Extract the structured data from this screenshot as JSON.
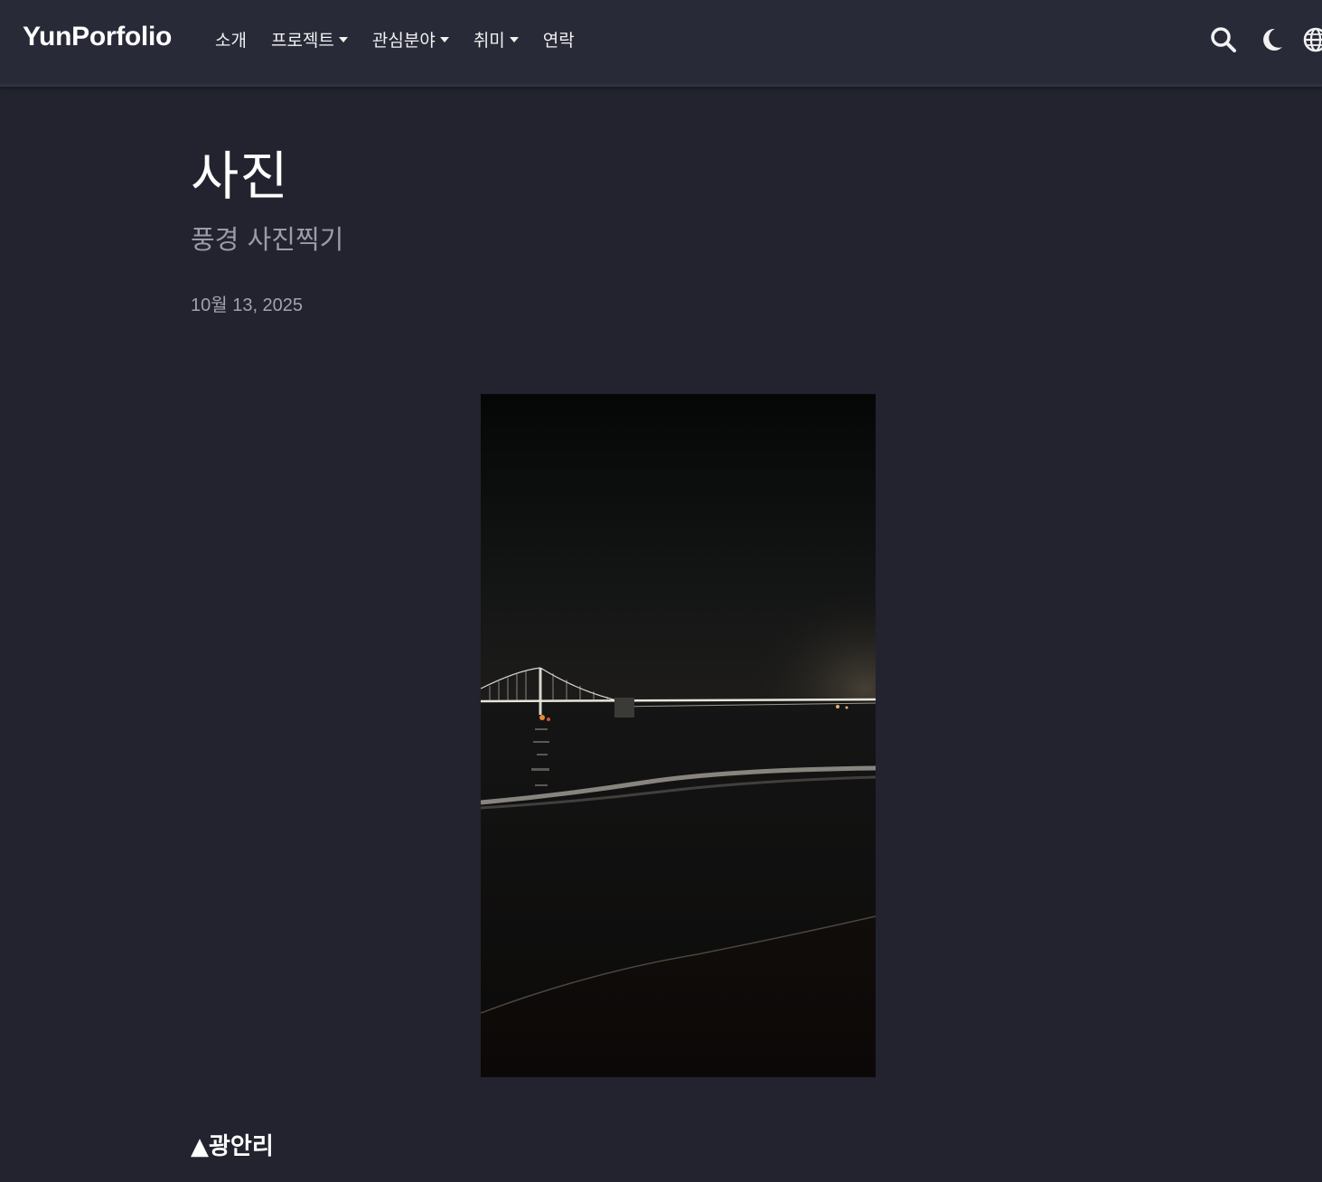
{
  "navbar": {
    "brand": "YunPorfolio",
    "items": [
      {
        "label": "소개",
        "dropdown": false
      },
      {
        "label": "프로젝트",
        "dropdown": true
      },
      {
        "label": "관심분야",
        "dropdown": true
      },
      {
        "label": "취미",
        "dropdown": true
      },
      {
        "label": "연락",
        "dropdown": false
      }
    ],
    "icons": [
      "search-icon",
      "moon-icon",
      "globe-icon"
    ]
  },
  "post": {
    "title": "사진",
    "subtitle": "풍경 사진찍기",
    "date": "10월 13, 2025",
    "caption": "▲광안리"
  },
  "colors": {
    "background": "#22232e",
    "navbar": "#282a38",
    "text": "#ffffff",
    "muted": "#9c9ca6"
  }
}
